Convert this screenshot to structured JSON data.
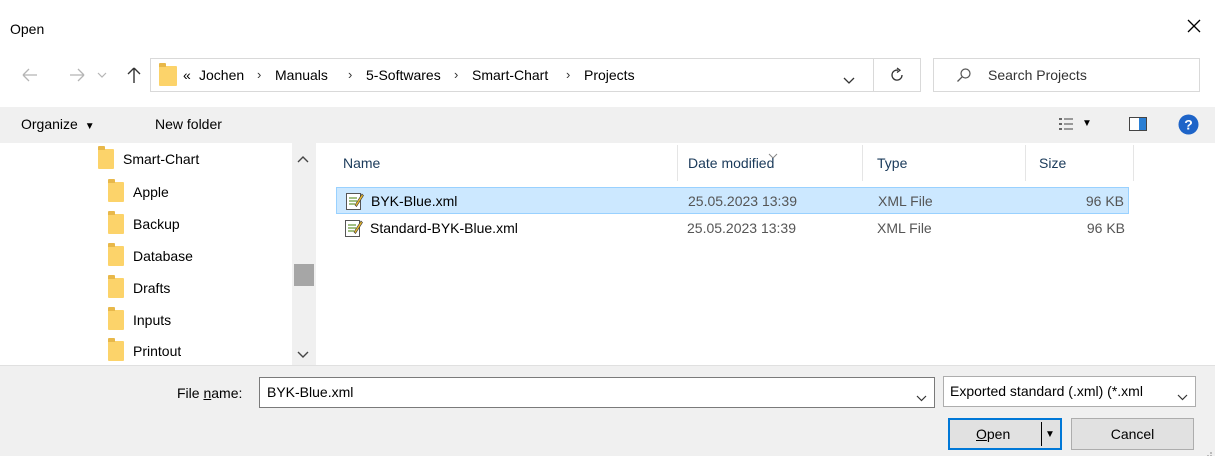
{
  "window": {
    "title": "Open"
  },
  "address": {
    "overflow": "«",
    "crumbs": [
      "Jochen",
      "Manuals",
      "5-Softwares",
      "Smart-Chart",
      "Projects"
    ]
  },
  "search": {
    "placeholder": "Search Projects"
  },
  "toolbar": {
    "organize_label": "Organize",
    "new_folder_label": "New folder"
  },
  "nav": {
    "items": [
      {
        "label": "Smart-Chart"
      },
      {
        "label": "Apple"
      },
      {
        "label": "Backup"
      },
      {
        "label": "Database"
      },
      {
        "label": "Drafts"
      },
      {
        "label": "Inputs"
      },
      {
        "label": "Printout"
      }
    ]
  },
  "columns": {
    "name": "Name",
    "date": "Date modified",
    "type": "Type",
    "size": "Size"
  },
  "files": [
    {
      "name": "BYK-Blue.xml",
      "date": "25.05.2023 13:39",
      "type": "XML File",
      "size": "96 KB",
      "selected": true
    },
    {
      "name": "Standard-BYK-Blue.xml",
      "date": "25.05.2023 13:39",
      "type": "XML File",
      "size": "96 KB",
      "selected": false
    }
  ],
  "bottom": {
    "file_name_label_pre": "File ",
    "file_name_label_u": "n",
    "file_name_label_post": "ame:",
    "file_name_value": "BYK-Blue.xml",
    "filter": "Exported standard (.xml) (*.xml",
    "open_u": "O",
    "open_rest": "pen",
    "cancel": "Cancel"
  },
  "colors": {
    "accent": "#0078d7",
    "selection": "#cce8ff",
    "help": "#1e64c8"
  }
}
